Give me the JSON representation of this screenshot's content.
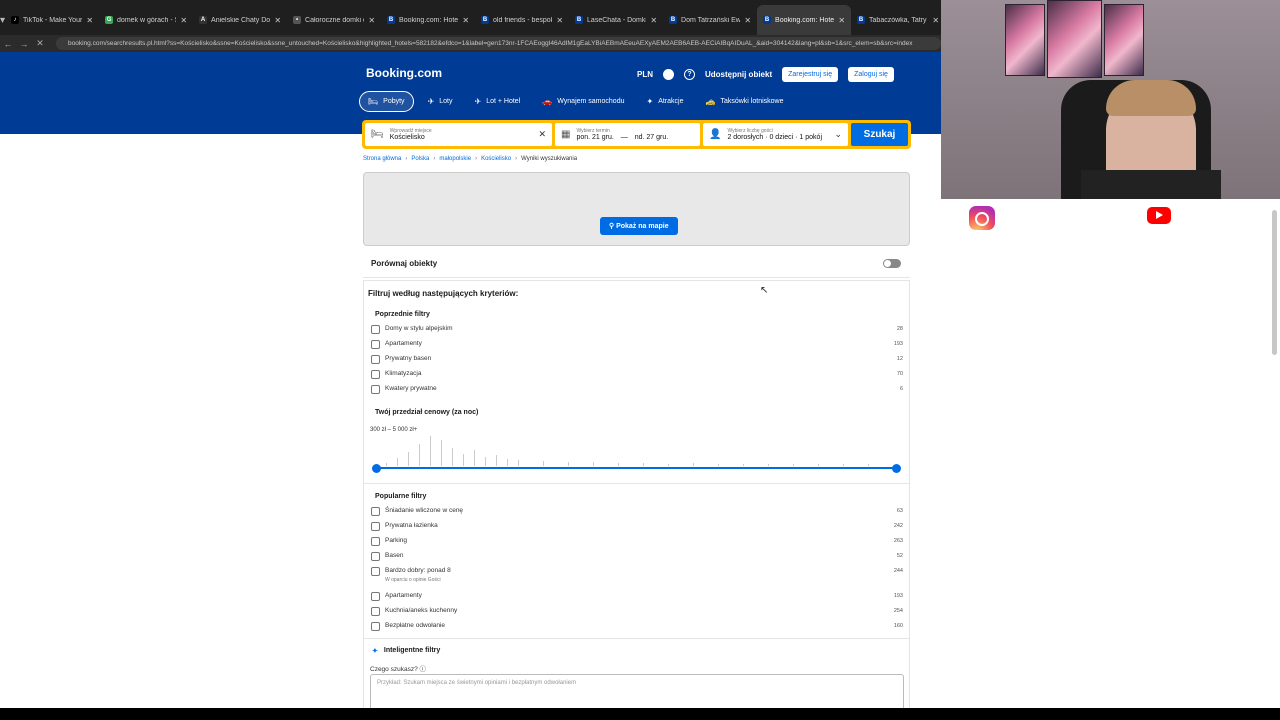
{
  "tabs": [
    {
      "title": "TikTok - Make Your Day",
      "color": "#000000",
      "glyph": "♪"
    },
    {
      "title": "domek w górach - Szukaj",
      "color": "#34a853",
      "glyph": "G"
    },
    {
      "title": "Anielskie Chaty Domki",
      "color": "#333333",
      "glyph": "A"
    },
    {
      "title": "Całoroczne domki drewniane",
      "color": "#555555",
      "glyph": "•"
    },
    {
      "title": "Booking.com: Hotele",
      "color": "#003b95",
      "glyph": "B"
    },
    {
      "title": "old friends - bespoke",
      "color": "#003b95",
      "glyph": "B"
    },
    {
      "title": "LaseChata - Domki w górach",
      "color": "#003b95",
      "glyph": "B"
    },
    {
      "title": "Dom Tatrzański Ewa, Kościelisko",
      "color": "#003b95",
      "glyph": "B"
    },
    {
      "title": "Booking.com: Hotele",
      "color": "#003b95",
      "glyph": "B"
    },
    {
      "title": "Tabaczówka, Tatry",
      "color": "#003b95",
      "glyph": "B"
    }
  ],
  "address": {
    "url": "booking.com/searchresults.pl.html?ss=Kościelisko&ssne=Kościelisko&ssne_untouched=Kościelisko&highlighted_hotels=582182&efdco=1&label=gen173nr-1FCAEoggI46AdIM1gEaLYBiAEBmAEeuAEXyAEM2AEB6AEB-AECiAIBqAIDuAL_&aid=304142&lang=pl&sb=1&src_elem=sb&src=index"
  },
  "header": {
    "logo": "Booking.com",
    "currency": "PLN",
    "list_property": "Udostępnij obiekt",
    "register": "Zarejestruj się",
    "login": "Zaloguj się"
  },
  "nav": [
    {
      "label": "Pobyty",
      "icon": "🛏"
    },
    {
      "label": "Loty",
      "icon": "✈"
    },
    {
      "label": "Lot + Hotel",
      "icon": "✈"
    },
    {
      "label": "Wynajem samochodu",
      "icon": "🚗"
    },
    {
      "label": "Atrakcje",
      "icon": "✦"
    },
    {
      "label": "Taksówki lotniskowe",
      "icon": "🚕"
    }
  ],
  "search": {
    "dest_label": "Wprowadź miejsce",
    "dest_value": "Kościelisko",
    "date_label": "Wybierz termin",
    "date_from": "pon. 21 gru.",
    "date_dash": "—",
    "date_to": "nd. 27 gru.",
    "guests_label": "Wybierz liczbę gości",
    "guests_value": "2 dorosłych · 0 dzieci · 1 pokój",
    "button": "Szukaj"
  },
  "breadcrumbs": [
    "Strona główna",
    "Polska",
    "małopolskie",
    "Kościelisko",
    "Wyniki wyszukiwania"
  ],
  "map_button": "Pokaż na mapie",
  "compare_label": "Porównaj obiekty",
  "filters": {
    "title": "Filtruj według następujących kryteriów:",
    "previous_title": "Poprzednie filtry",
    "previous": [
      {
        "label": "Domy w stylu alpejskim",
        "count": "28"
      },
      {
        "label": "Apartamenty",
        "count": "193"
      },
      {
        "label": "Prywatny basen",
        "count": "12"
      },
      {
        "label": "Klimatyzacja",
        "count": "70"
      },
      {
        "label": "Kwatery prywatne",
        "count": "6"
      }
    ],
    "price_title": "Twój przedział cenowy (za noc)",
    "price_range": "300 zł – 5 000 zł+",
    "price_min_fraction": 0.0,
    "price_max_fraction": 1.0,
    "popular_title": "Popularne filtry",
    "popular": [
      {
        "label": "Śniadanie wliczone w cenę",
        "count": "63",
        "sub": ""
      },
      {
        "label": "Prywatna łazienka",
        "count": "242",
        "sub": ""
      },
      {
        "label": "Parking",
        "count": "263",
        "sub": ""
      },
      {
        "label": "Basen",
        "count": "52",
        "sub": ""
      },
      {
        "label": "Bardzo dobry: ponad 8",
        "count": "244",
        "sub": "W oparciu o opinie Gości"
      },
      {
        "label": "Apartamenty",
        "count": "193",
        "sub": ""
      },
      {
        "label": "Kuchnia/aneks kuchenny",
        "count": "254",
        "sub": ""
      },
      {
        "label": "Bezpłatne odwołanie",
        "count": "160",
        "sub": ""
      }
    ],
    "smart_title": "Inteligentne filtry",
    "ask_label": "Czego szukasz?",
    "ask_placeholder": "Przykład: Szukam miejsca ze świetnymi opiniami i bezpłatnym odwołaniem"
  }
}
